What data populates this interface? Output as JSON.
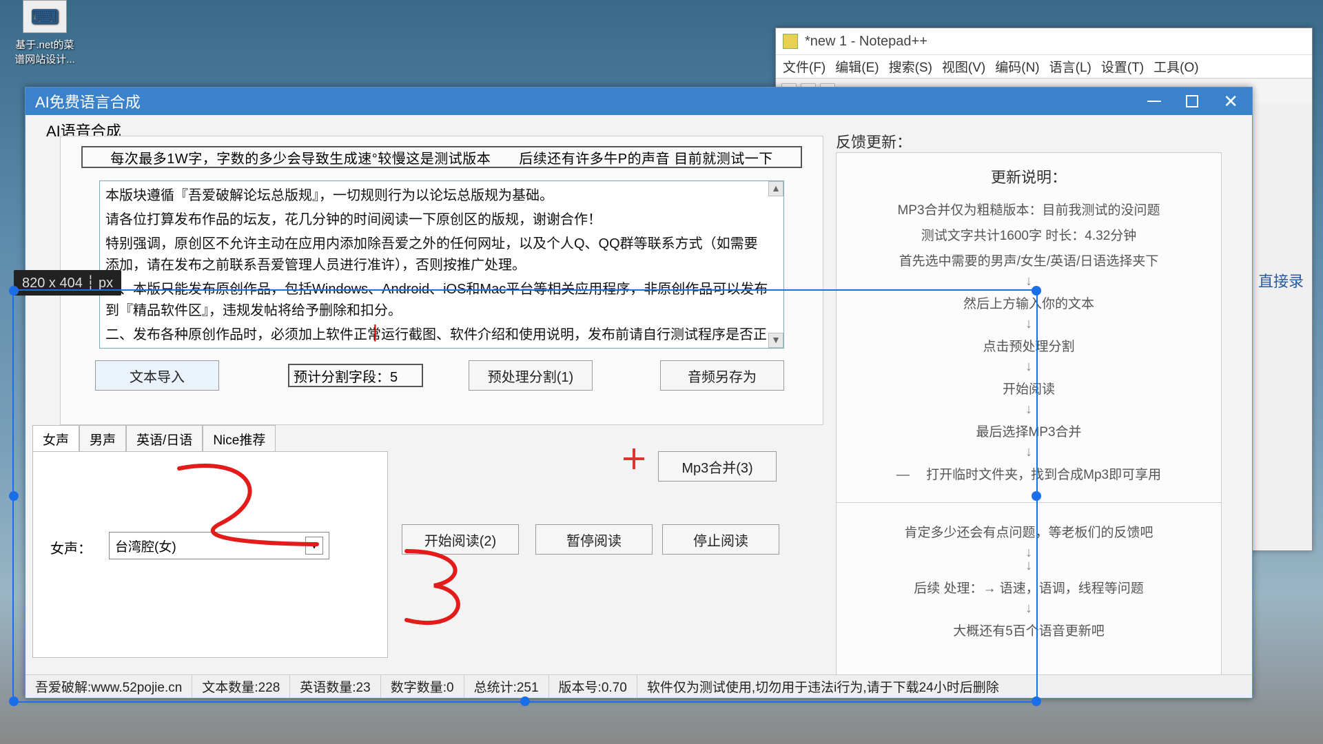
{
  "desktop": {
    "icon1_label": "基于.net的菜谱网站设计..."
  },
  "notepad": {
    "title": "*new 1 - Notepad++",
    "menu": [
      "文件(F)",
      "编辑(E)",
      "搜索(S)",
      "视图(V)",
      "编码(N)",
      "语言(L)",
      "设置(T)",
      "工具(O)"
    ],
    "side_text": "直接录"
  },
  "aiwin": {
    "title": "AI免费语言合成",
    "section_title": "AI语音合成",
    "banner": "每次最多1W字，字数的多少会导致生成速°较慢这是测试版本　　后续还有许多牛P的声音 目前就测试一下",
    "textarea_lines": [
      "本版块遵循『吾爱破解论坛总版规』，一切规则行为以论坛总版规为基础。",
      "",
      "请各位打算发布作品的坛友，花几分钟的时间阅读一下原创区的版规，谢谢合作！",
      "特别强调，原创区不允许主动在应用内添加除吾爱之外的任何网址，以及个人Q、QQ群等联系方式（如需要添加，请在发布之前联系吾爱管理人员进行准许），否则按推广处理。",
      "一、本版只能发布原创作品，包括Windows、Android、iOS和Mac平台等相关应用程序，非原创作品可以发布到『精品软件区』，违规发帖将给予删除和扣分。",
      "二、发布各种原创作品时，必须加上软件正常运行截图、软件介绍和使用说明，发布前请自行测试程序是否正常工作。"
    ],
    "btn_import": "文本导入",
    "seg_count": "预计分割字段：5",
    "btn_preprocess": "预处理分割(1)",
    "btn_audio_saveas": "音频另存为",
    "tabs": [
      "女声",
      "男声",
      "英语/日语",
      "Nice推荐"
    ],
    "voice_label": "女声：",
    "voice_value": "台湾腔(女)",
    "btn_start": "开始阅读(2)",
    "btn_pause": "暂停阅读",
    "btn_stop": "停止阅读",
    "btn_mp3": "Mp3合并(3)"
  },
  "feedback": {
    "label": "反馈更新：",
    "update_title": "更新说明：",
    "top_lines": [
      "MP3合并仅为粗糙版本：目前我测试的没问题",
      "测试文字共计1600字 时长：4.32分钟",
      "首先选中需要的男声/女生/英语/日语选择夹下",
      "然后上方输入你的文本",
      "点击预处理分割",
      "开始阅读",
      "最后选择MP3合并",
      "— 　打开临时文件夹，找到合成Mp3即可享用"
    ],
    "bot_lines": [
      "肯定多少还会有点问题，等老板们的反馈吧",
      "后续 处理：→ 语速，语调，线程等问题",
      "大概还有5百个语音更新吧"
    ]
  },
  "status": {
    "site": "吾爱破解:www.52pojie.cn",
    "text_count": "文本数量:228",
    "eng_count": "英语数量:23",
    "num_count": "数字数量:0",
    "total": "总统计:251",
    "version": "版本号:0.70",
    "warning": "软件仅为测试使用,切勿用于违法i行为,请于下载24小时后删除"
  },
  "selection": {
    "label": "820 x 404 ┆ px"
  }
}
